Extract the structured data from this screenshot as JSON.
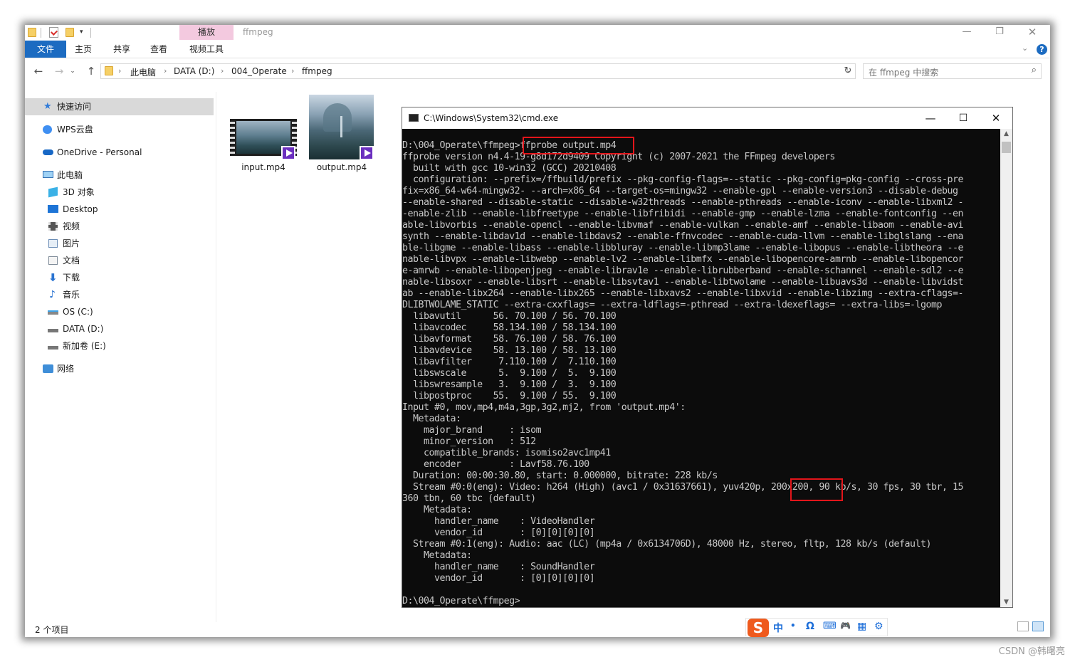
{
  "explorer": {
    "window_title": "ffmpeg",
    "context_tab": "播放",
    "ribbon_tabs": [
      "文件",
      "主页",
      "共享",
      "查看",
      "视频工具"
    ],
    "breadcrumb": [
      "此电脑",
      "DATA (D:)",
      "004_Operate",
      "ffmpeg"
    ],
    "search_placeholder": "在 ffmpeg 中搜索",
    "sidebar": [
      {
        "label": "快速访问",
        "icon": "star-icon"
      },
      {
        "label": "WPS云盘",
        "icon": "wps-cloud-icon"
      },
      {
        "label": "OneDrive - Personal",
        "icon": "onedrive-icon"
      },
      {
        "label": "此电脑",
        "icon": "computer-icon"
      },
      {
        "label": "3D 对象",
        "icon": "3d-objects-icon"
      },
      {
        "label": "Desktop",
        "icon": "desktop-icon"
      },
      {
        "label": "视频",
        "icon": "videos-icon"
      },
      {
        "label": "图片",
        "icon": "pictures-icon"
      },
      {
        "label": "文档",
        "icon": "documents-icon"
      },
      {
        "label": "下载",
        "icon": "downloads-icon"
      },
      {
        "label": "音乐",
        "icon": "music-icon"
      },
      {
        "label": "OS (C:)",
        "icon": "drive-icon"
      },
      {
        "label": "DATA (D:)",
        "icon": "drive-icon"
      },
      {
        "label": "新加卷 (E:)",
        "icon": "drive-icon"
      },
      {
        "label": "网络",
        "icon": "network-icon"
      }
    ],
    "files": [
      {
        "name": "input.mp4"
      },
      {
        "name": "output.mp4"
      }
    ],
    "status": "2 个项目"
  },
  "cmd": {
    "title": "C:\\Windows\\System32\\cmd.exe",
    "lines": [
      "D:\\004_Operate\\ffmpeg>ffprobe output.mp4",
      "ffprobe version n4.4-19-g8d172d9409 Copyright (c) 2007-2021 the FFmpeg developers",
      "  built with gcc 10-win32 (GCC) 20210408",
      "  configuration: --prefix=/ffbuild/prefix --pkg-config-flags=--static --pkg-config=pkg-config --cross-pre",
      "fix=x86_64-w64-mingw32- --arch=x86_64 --target-os=mingw32 --enable-gpl --enable-version3 --disable-debug",
      "--enable-shared --disable-static --disable-w32threads --enable-pthreads --enable-iconv --enable-libxml2 -",
      "-enable-zlib --enable-libfreetype --enable-libfribidi --enable-gmp --enable-lzma --enable-fontconfig --en",
      "able-libvorbis --enable-opencl --enable-libvmaf --enable-vulkan --enable-amf --enable-libaom --enable-avi",
      "synth --enable-libdav1d --enable-libdavs2 --enable-ffnvcodec --enable-cuda-llvm --enable-libglslang --ena",
      "ble-libgme --enable-libass --enable-libbluray --enable-libmp3lame --enable-libopus --enable-libtheora --e",
      "nable-libvpx --enable-libwebp --enable-lv2 --enable-libmfx --enable-libopencore-amrnb --enable-libopencor",
      "e-amrwb --enable-libopenjpeg --enable-librav1e --enable-librubberband --enable-schannel --enable-sdl2 --e",
      "nable-libsoxr --enable-libsrt --enable-libsvtav1 --enable-libtwolame --enable-libuavs3d --enable-libvidst",
      "ab --enable-libx264 --enable-libx265 --enable-libxavs2 --enable-libxvid --enable-libzimg --extra-cflags=-",
      "DLIBTWOLAME_STATIC --extra-cxxflags= --extra-ldflags=-pthread --extra-ldexeflags= --extra-libs=-lgomp",
      "  libavutil      56. 70.100 / 56. 70.100",
      "  libavcodec     58.134.100 / 58.134.100",
      "  libavformat    58. 76.100 / 58. 76.100",
      "  libavdevice    58. 13.100 / 58. 13.100",
      "  libavfilter     7.110.100 /  7.110.100",
      "  libswscale      5.  9.100 /  5.  9.100",
      "  libswresample   3.  9.100 /  3.  9.100",
      "  libpostproc    55.  9.100 / 55.  9.100",
      "Input #0, mov,mp4,m4a,3gp,3g2,mj2, from 'output.mp4':",
      "  Metadata:",
      "    major_brand     : isom",
      "    minor_version   : 512",
      "    compatible_brands: isomiso2avc1mp41",
      "    encoder         : Lavf58.76.100",
      "  Duration: 00:00:30.80, start: 0.000000, bitrate: 228 kb/s",
      "  Stream #0:0(eng): Video: h264 (High) (avc1 / 0x31637661), yuv420p, 200x200, 90 kb/s, 30 fps, 30 tbr, 15",
      "360 tbn, 60 tbc (default)",
      "    Metadata:",
      "      handler_name    : VideoHandler",
      "      vendor_id       : [0][0][0][0]",
      "  Stream #0:1(eng): Audio: aac (LC) (mp4a / 0x6134706D), 48000 Hz, stereo, fltp, 128 kb/s (default)",
      "    Metadata:",
      "      handler_name    : SoundHandler",
      "      vendor_id       : [0][0][0][0]",
      "",
      "D:\\004_Operate\\ffmpeg>"
    ]
  },
  "ime": {
    "logo": "S",
    "items": [
      "中",
      "•",
      "Ω",
      "⌨",
      "🎮",
      "▦",
      "⚙"
    ]
  },
  "watermark": "CSDN @韩曙亮"
}
